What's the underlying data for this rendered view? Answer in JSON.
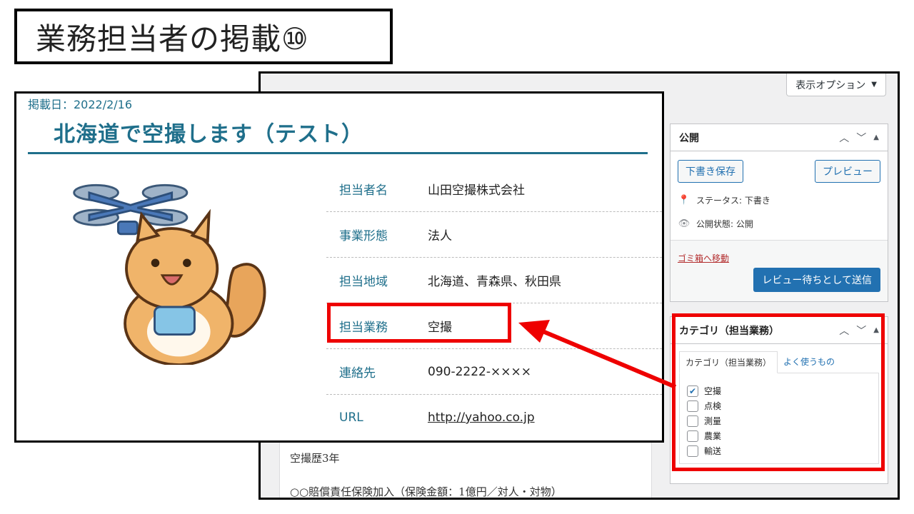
{
  "slide": {
    "title": "業務担当者の掲載⑩"
  },
  "wp": {
    "screen_options": "表示オプション",
    "editor_lines": [
      "空撮歴3年",
      "○○賠償責任保険加入（保険金額：1億円／対人・対物）"
    ],
    "publish": {
      "title": "公開",
      "save_draft": "下書き保存",
      "preview": "プレビュー",
      "status": "ステータス: 下書き",
      "visibility": "公開状態: 公開",
      "trash": "ゴミ箱へ移動",
      "submit": "レビュー待ちとして送信"
    },
    "category": {
      "title": "カテゴリ（担当業務）",
      "tabs": [
        "カテゴリ（担当業務）",
        "よく使うもの"
      ],
      "items": [
        {
          "label": "空撮",
          "checked": true
        },
        {
          "label": "点検",
          "checked": false
        },
        {
          "label": "測量",
          "checked": false
        },
        {
          "label": "農業",
          "checked": false
        },
        {
          "label": "輸送",
          "checked": false
        }
      ]
    }
  },
  "post": {
    "date": "掲載日：2022/2/16",
    "title": "北海道で空撮します（テスト）",
    "rows": [
      {
        "label": "担当者名",
        "value": "山田空撮株式会社"
      },
      {
        "label": "事業形態",
        "value": "法人"
      },
      {
        "label": "担当地域",
        "value": "北海道、青森県、秋田県"
      },
      {
        "label": "担当業務",
        "value": "空撮"
      },
      {
        "label": "連絡先",
        "value": "090-2222-××××"
      },
      {
        "label": "URL",
        "value": "http://yahoo.co.jp"
      }
    ]
  },
  "colors": {
    "accent": "#1f6f8b",
    "highlight": "#ee0000",
    "wp_blue": "#2271b1"
  }
}
